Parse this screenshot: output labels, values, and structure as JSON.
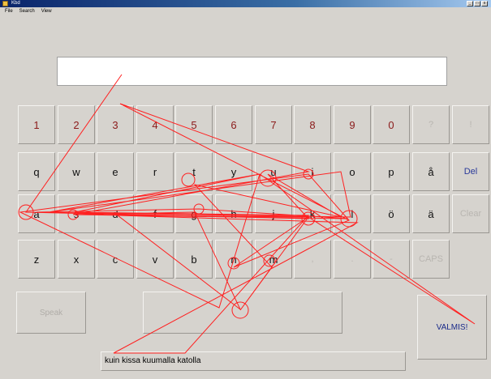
{
  "window": {
    "title": "Kbd",
    "controls": [
      "_",
      "□",
      "x"
    ]
  },
  "menu": [
    "File",
    "Search",
    "View"
  ],
  "text_field": {
    "value": ""
  },
  "keyboard": {
    "rows": [
      [
        {
          "label": "1",
          "style": "num"
        },
        {
          "label": "2",
          "style": "num"
        },
        {
          "label": "3",
          "style": "num"
        },
        {
          "label": "4",
          "style": "num"
        },
        {
          "label": "5",
          "style": "num"
        },
        {
          "label": "6",
          "style": "num"
        },
        {
          "label": "7",
          "style": "num"
        },
        {
          "label": "8",
          "style": "num"
        },
        {
          "label": "9",
          "style": "num"
        },
        {
          "label": "0",
          "style": "num"
        },
        {
          "label": "?",
          "style": "disabled"
        },
        {
          "label": "!",
          "style": "disabled"
        }
      ],
      [
        {
          "label": "q"
        },
        {
          "label": "w"
        },
        {
          "label": "e"
        },
        {
          "label": "r"
        },
        {
          "label": "t"
        },
        {
          "label": "y"
        },
        {
          "label": "u"
        },
        {
          "label": "i"
        },
        {
          "label": "o"
        },
        {
          "label": "p"
        },
        {
          "label": "å"
        },
        {
          "label": "Del",
          "style": "blue"
        }
      ],
      [
        {
          "label": "a"
        },
        {
          "label": "s"
        },
        {
          "label": "d"
        },
        {
          "label": "f"
        },
        {
          "label": "g"
        },
        {
          "label": "h"
        },
        {
          "label": "j"
        },
        {
          "label": "k"
        },
        {
          "label": "l"
        },
        {
          "label": "ö"
        },
        {
          "label": "ä"
        },
        {
          "label": "Clear",
          "style": "disabled"
        }
      ],
      [
        {
          "label": "z"
        },
        {
          "label": "x"
        },
        {
          "label": "c"
        },
        {
          "label": "v"
        },
        {
          "label": "b"
        },
        {
          "label": "n"
        },
        {
          "label": "m"
        },
        {
          "label": ",",
          "style": "disabled"
        },
        {
          "label": ".",
          "style": "disabled"
        },
        {
          "label": "-",
          "style": "disabled"
        },
        {
          "label": "CAPS",
          "style": "disabled"
        }
      ]
    ],
    "speak_label": "Speak",
    "space_label": "",
    "done_label": "VALMIS!"
  },
  "target_phrase": "kuin kissa kuumalla katolla",
  "trace_color": "#ff2020"
}
